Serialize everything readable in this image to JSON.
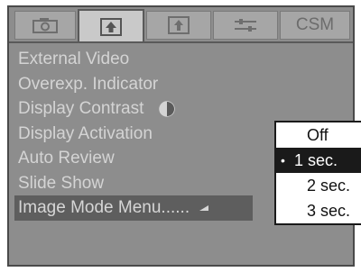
{
  "tabs": [
    {
      "name": "camera-tab",
      "icon": "camera-icon",
      "label": ""
    },
    {
      "name": "playback-tab",
      "icon": "playback-icon",
      "label": ""
    },
    {
      "name": "setup-tab",
      "icon": "setup-icon",
      "label": ""
    },
    {
      "name": "custom-tab",
      "icon": "custom-icon",
      "label": ""
    },
    {
      "name": "csm-tab",
      "icon": "",
      "label": "CSM"
    }
  ],
  "menu": {
    "items": [
      {
        "label": "External Video"
      },
      {
        "label": "Overexp. Indicator"
      },
      {
        "label": "Display Contrast"
      },
      {
        "label": "Display Activation"
      },
      {
        "label": "Auto Review"
      },
      {
        "label": "Slide Show"
      },
      {
        "label": "Image Mode Menu......"
      }
    ]
  },
  "popup": {
    "options": [
      {
        "label": "Off"
      },
      {
        "label": "1 sec.",
        "bullet": "•"
      },
      {
        "label": "2 sec."
      },
      {
        "label": "3 sec."
      }
    ]
  }
}
